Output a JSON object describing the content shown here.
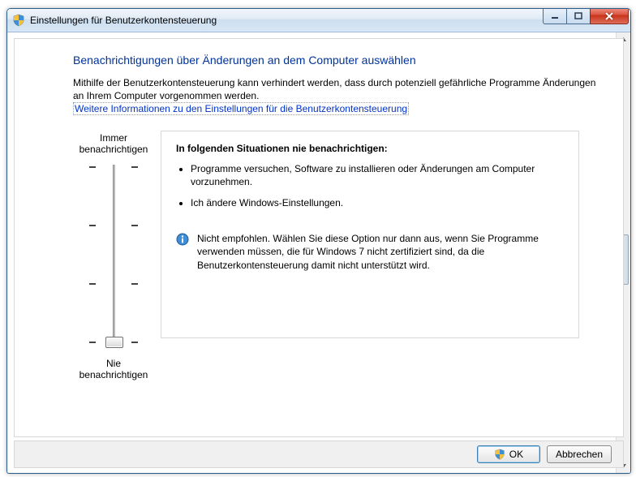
{
  "window": {
    "title": "Einstellungen für Benutzerkontensteuerung"
  },
  "heading": "Benachrichtigungen über Änderungen an dem Computer auswählen",
  "description": "Mithilfe der Benutzerkontensteuerung kann verhindert werden, dass durch potenziell gefährliche Programme Änderungen an Ihrem Computer vorgenommen werden.",
  "more_link": "Weitere Informationen zu den Einstellungen für die Benutzerkontensteuerung",
  "slider": {
    "top_label": "Immer benachrichtigen",
    "bottom_label": "Nie benachrichtigen",
    "info_title": "In folgenden Situationen nie benachrichtigen:",
    "bullet1": "Programme versuchen, Software zu installieren oder Änderungen am Computer vorzunehmen.",
    "bullet2": "Ich ändere Windows-Einstellungen.",
    "note": "Nicht empfohlen. Wählen Sie diese Option nur dann aus, wenn Sie Programme verwenden müssen, die für Windows 7 nicht zertifiziert sind, da die Benutzerkontensteuerung damit nicht unterstützt wird."
  },
  "buttons": {
    "ok": "OK",
    "cancel": "Abbrechen"
  }
}
